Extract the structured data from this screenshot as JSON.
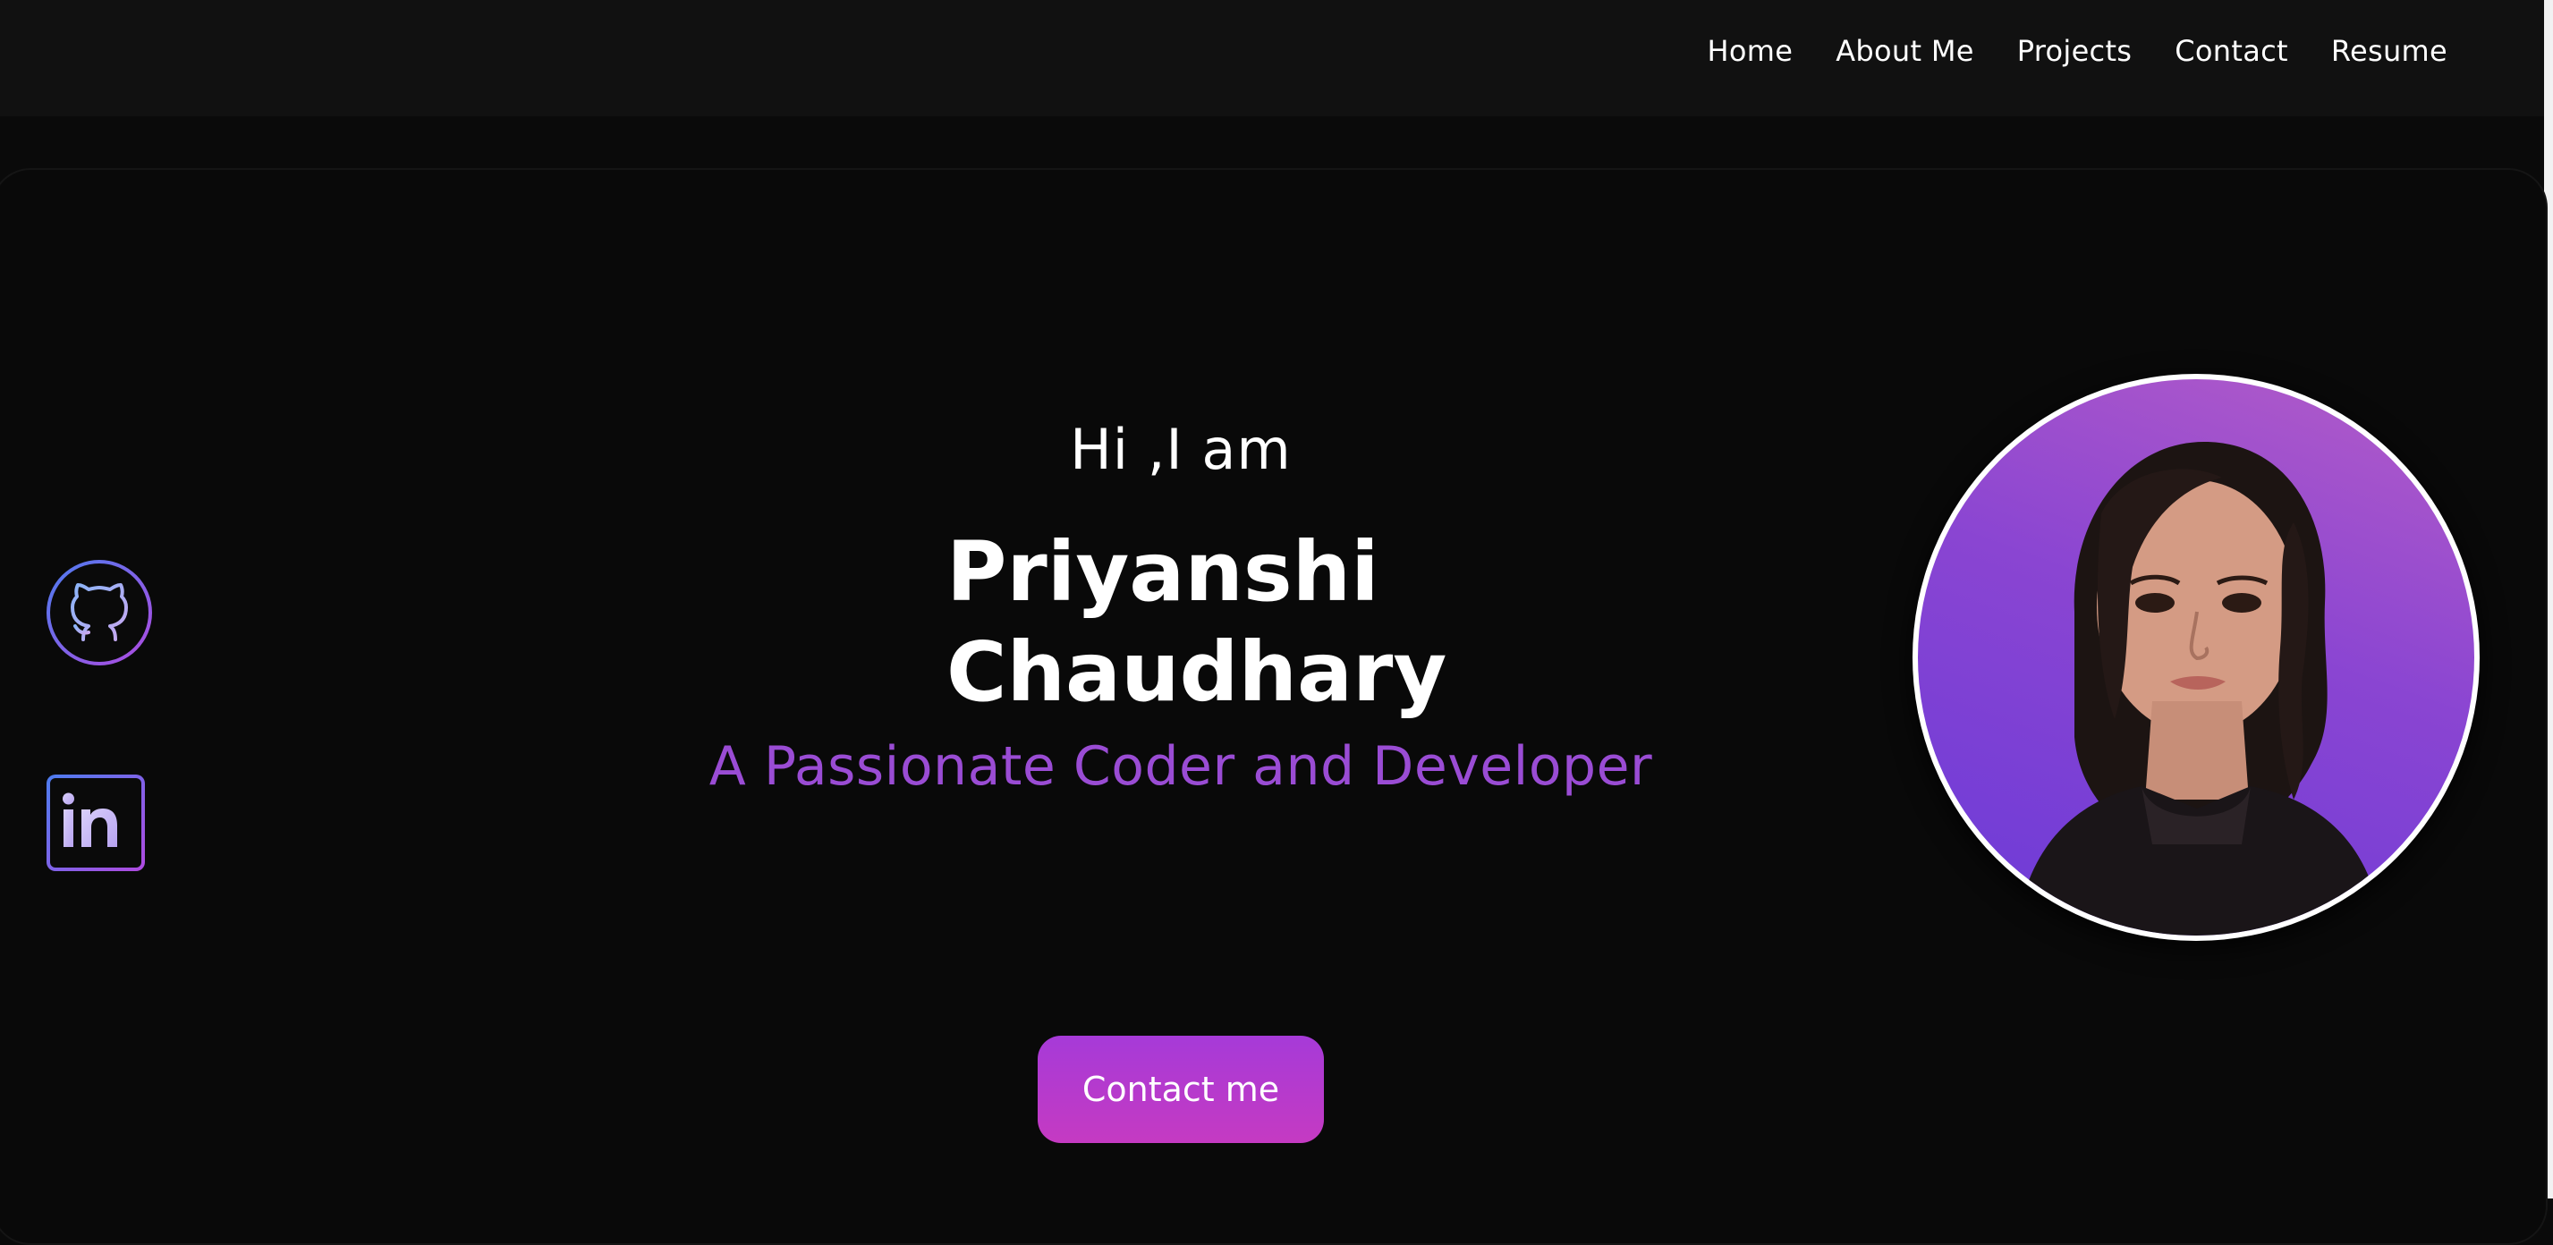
{
  "nav": {
    "items": [
      {
        "label": "Home"
      },
      {
        "label": "About Me"
      },
      {
        "label": "Projects"
      },
      {
        "label": "Contact"
      },
      {
        "label": "Resume"
      }
    ]
  },
  "hero": {
    "greeting": "Hi ,I am",
    "name_first": "Priyanshi",
    "name_last": "Chaudhary",
    "tagline": "A Passionate Coder and Developer",
    "contact_button": "Contact me"
  },
  "social": {
    "github_icon": "github-icon",
    "linkedin_icon": "linkedin-icon",
    "linkedin_text": "in"
  },
  "colors": {
    "page_background": "#0a0a0a",
    "navbar_background": "#111111",
    "accent_purple": "#9a4cd4",
    "button_gradient_top": "#a63ad8",
    "button_gradient_bottom": "#c53ac2",
    "icon_gradient_start": "#4c7df0",
    "icon_gradient_end": "#b04ae0"
  }
}
